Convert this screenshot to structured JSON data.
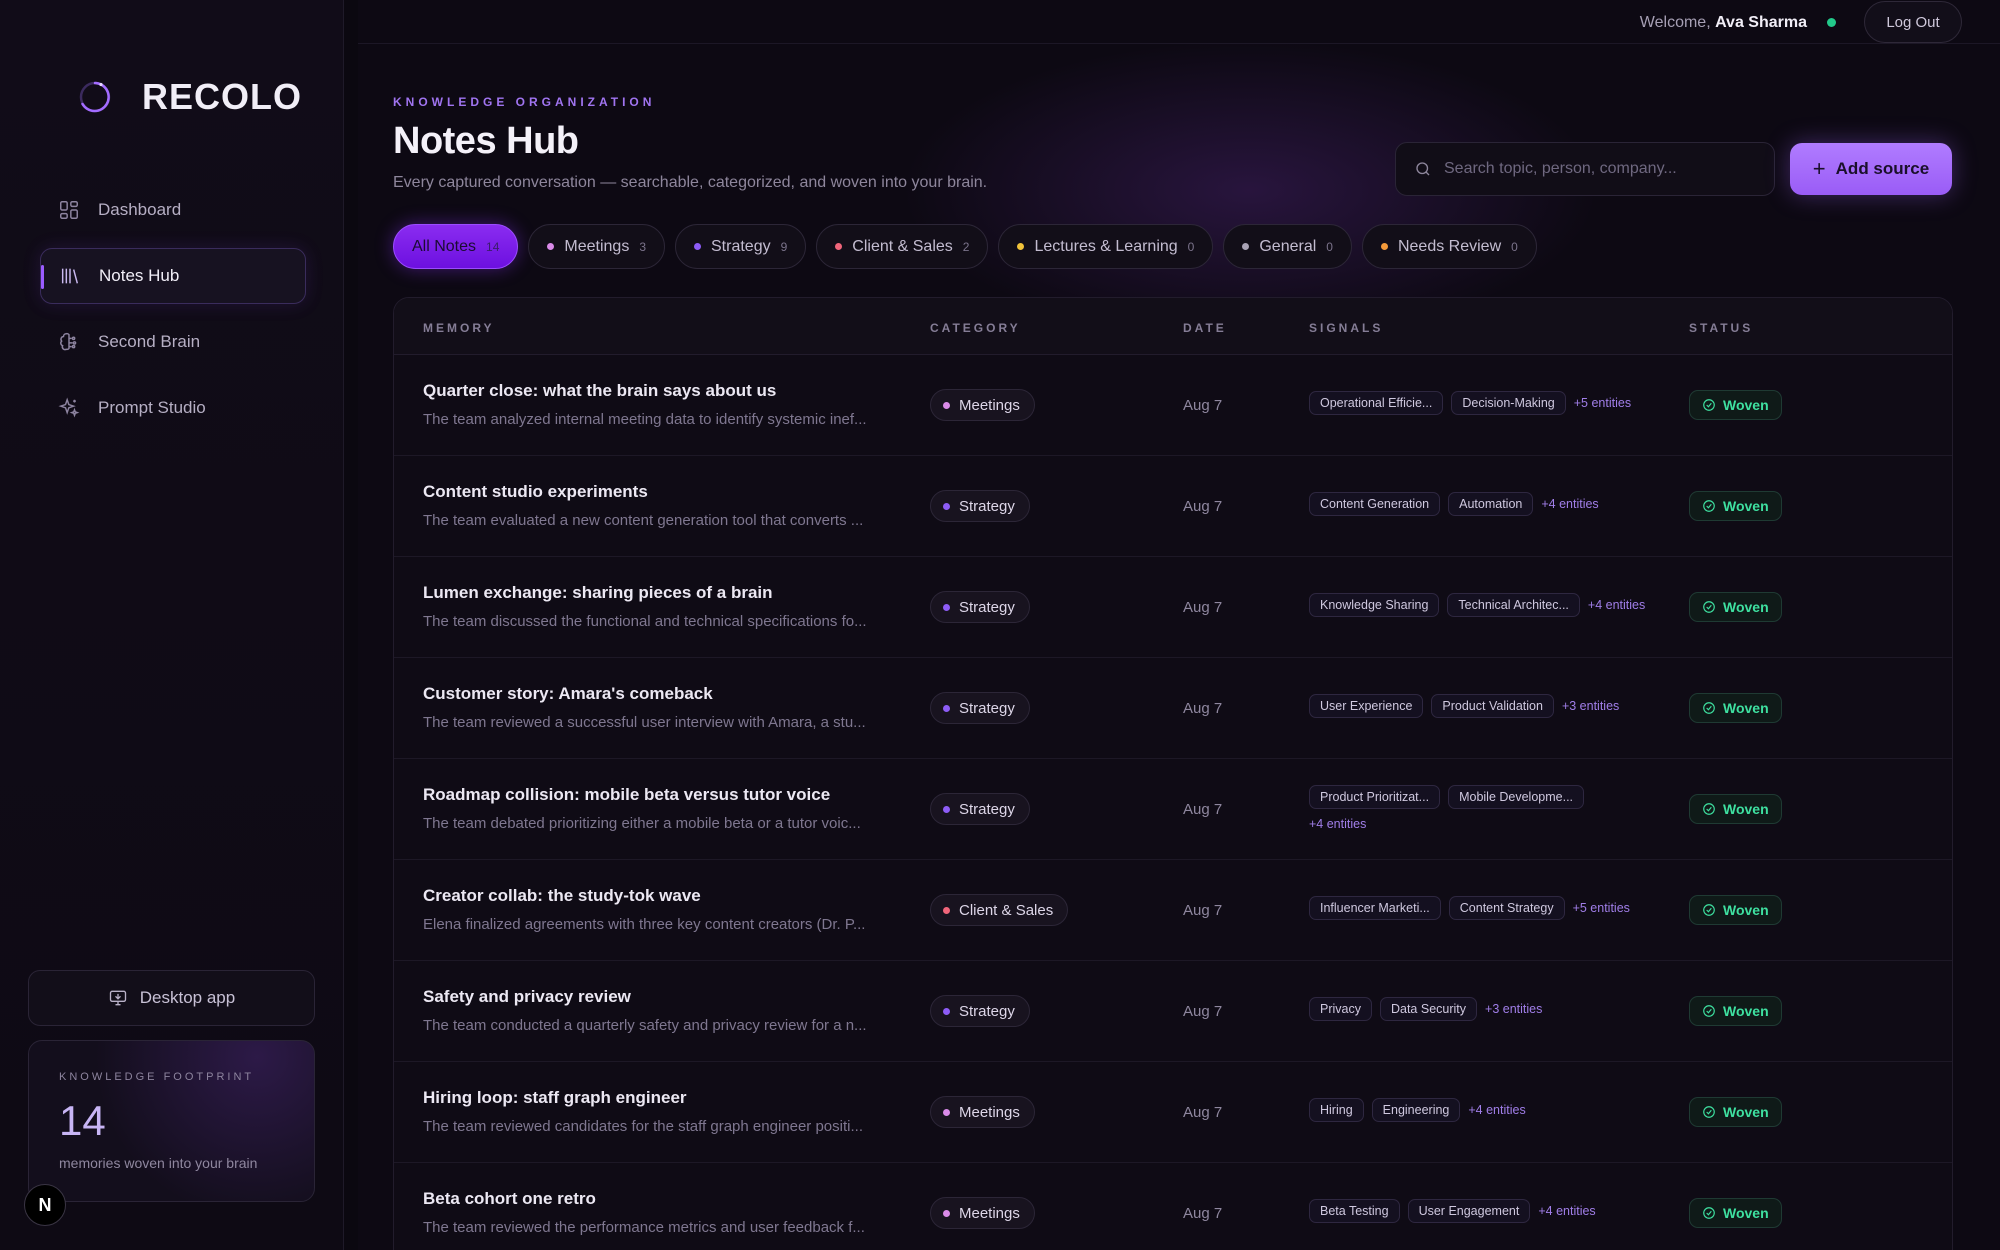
{
  "brand": {
    "name": "RECOLO"
  },
  "sidebar": {
    "items": [
      {
        "label": "Dashboard",
        "icon": "grid-icon"
      },
      {
        "label": "Notes Hub",
        "icon": "library-icon",
        "active": true
      },
      {
        "label": "Second Brain",
        "icon": "brain-icon"
      },
      {
        "label": "Prompt Studio",
        "icon": "sparkle-icon"
      }
    ],
    "desktop_app_label": "Desktop app",
    "footprint": {
      "label": "KNOWLEDGE FOOTPRINT",
      "count": "14",
      "sub": "memories woven into your brain"
    },
    "badge_letter": "N"
  },
  "topbar": {
    "welcome_prefix": "Welcome,",
    "user_name": "Ava Sharma",
    "logout_label": "Log Out"
  },
  "header": {
    "eyebrow": "KNOWLEDGE ORGANIZATION",
    "title": "Notes Hub",
    "subtitle": "Every captured conversation — searchable, categorized, and woven into your brain.",
    "search_placeholder": "Search topic, person, company...",
    "add_label": "Add source"
  },
  "filters": [
    {
      "label": "All Notes",
      "count": "14",
      "active": true,
      "color": ""
    },
    {
      "label": "Meetings",
      "count": "3",
      "color": "#d98ae8"
    },
    {
      "label": "Strategy",
      "count": "9",
      "color": "#8d5cf6"
    },
    {
      "label": "Client & Sales",
      "count": "2",
      "color": "#f0657a"
    },
    {
      "label": "Lectures & Learning",
      "count": "0",
      "color": "#f0c23a"
    },
    {
      "label": "General",
      "count": "0",
      "color": "#a9a2b5"
    },
    {
      "label": "Needs Review",
      "count": "0",
      "color": "#f59a3a"
    }
  ],
  "table": {
    "headers": [
      "MEMORY",
      "CATEGORY",
      "DATE",
      "SIGNALS",
      "STATUS"
    ],
    "rows": [
      {
        "title": "Quarter close: what the brain says about us",
        "desc": "The team analyzed internal meeting data to identify systemic inef...",
        "category": "Meetings",
        "cat_color": "#d98ae8",
        "date": "Aug 7",
        "tags": [
          "Operational Efficie...",
          "Decision-Making"
        ],
        "more": "+5 entities",
        "status": "Woven"
      },
      {
        "title": "Content studio experiments",
        "desc": "The team evaluated a new content generation tool that converts ...",
        "category": "Strategy",
        "cat_color": "#8d5cf6",
        "date": "Aug 7",
        "tags": [
          "Content Generation",
          "Automation"
        ],
        "more": "+4 entities",
        "status": "Woven"
      },
      {
        "title": "Lumen exchange: sharing pieces of a brain",
        "desc": "The team discussed the functional and technical specifications fo...",
        "category": "Strategy",
        "cat_color": "#8d5cf6",
        "date": "Aug 7",
        "tags": [
          "Knowledge Sharing",
          "Technical Architec..."
        ],
        "more": "+4 entities",
        "status": "Woven"
      },
      {
        "title": "Customer story: Amara's comeback",
        "desc": "The team reviewed a successful user interview with Amara, a stu...",
        "category": "Strategy",
        "cat_color": "#8d5cf6",
        "date": "Aug 7",
        "tags": [
          "User Experience",
          "Product Validation"
        ],
        "more": "+3 entities",
        "status": "Woven"
      },
      {
        "title": "Roadmap collision: mobile beta versus tutor voice",
        "desc": "The team debated prioritizing either a mobile beta or a tutor voic...",
        "category": "Strategy",
        "cat_color": "#8d5cf6",
        "date": "Aug 7",
        "tags": [
          "Product Prioritizat...",
          "Mobile Developme..."
        ],
        "more": "+4 entities",
        "status": "Woven",
        "wrap": true
      },
      {
        "title": "Creator collab: the study-tok wave",
        "desc": "Elena finalized agreements with three key content creators (Dr. P...",
        "category": "Client & Sales",
        "cat_color": "#f0657a",
        "date": "Aug 7",
        "tags": [
          "Influencer Marketi...",
          "Content Strategy"
        ],
        "more": "+5 entities",
        "status": "Woven"
      },
      {
        "title": "Safety and privacy review",
        "desc": "The team conducted a quarterly safety and privacy review for a n...",
        "category": "Strategy",
        "cat_color": "#8d5cf6",
        "date": "Aug 7",
        "tags": [
          "Privacy",
          "Data Security"
        ],
        "more": "+3 entities",
        "status": "Woven"
      },
      {
        "title": "Hiring loop: staff graph engineer",
        "desc": "The team reviewed candidates for the staff graph engineer positi...",
        "category": "Meetings",
        "cat_color": "#d98ae8",
        "date": "Aug 7",
        "tags": [
          "Hiring",
          "Engineering"
        ],
        "more": "+4 entities",
        "status": "Woven"
      },
      {
        "title": "Beta cohort one retro",
        "desc": "The team reviewed the performance metrics and user feedback f...",
        "category": "Meetings",
        "cat_color": "#d98ae8",
        "date": "Aug 7",
        "tags": [
          "Beta Testing",
          "User Engagement"
        ],
        "more": "+4 entities",
        "status": "Woven"
      }
    ]
  },
  "colors": {
    "accent": "#9b5cff",
    "woven": "#3ee0a0",
    "online": "#22c98a"
  }
}
